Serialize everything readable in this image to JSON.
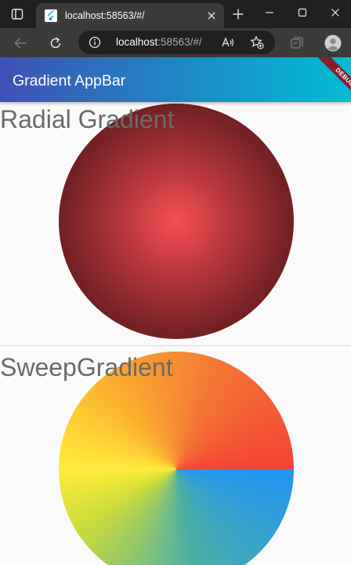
{
  "browser": {
    "tab": {
      "title": "localhost:58563/#/"
    },
    "address_bar": {
      "url_host": "localhost",
      "url_rest": ":58563/#/"
    }
  },
  "app": {
    "appbar": {
      "title": "Gradient AppBar",
      "gradient": [
        "#3f51b5",
        "#00bcd4"
      ]
    },
    "debug_banner": "DEBUG",
    "sections": [
      {
        "label": "Radial Gradient",
        "colors": [
          "#f44f55",
          "#4a1416"
        ]
      },
      {
        "label": "SweepGradient",
        "colors": [
          "#2196f3",
          "#cddc39",
          "#ffeb3b",
          "#f57834",
          "#f44336"
        ]
      }
    ]
  },
  "icons": {
    "tab_actions": "tab-actions-icon",
    "favicon": "flutter-icon",
    "close_tab": "close-icon",
    "new_tab": "plus-icon",
    "minimize": "minimize-icon",
    "maximize": "maximize-icon",
    "close_window": "close-icon",
    "back": "back-arrow-icon",
    "refresh": "refresh-icon",
    "site_info": "info-icon",
    "read_aloud": "read-aloud-icon",
    "favorites": "star-plus-icon",
    "collections": "collections-icon",
    "profile": "profile-icon"
  }
}
